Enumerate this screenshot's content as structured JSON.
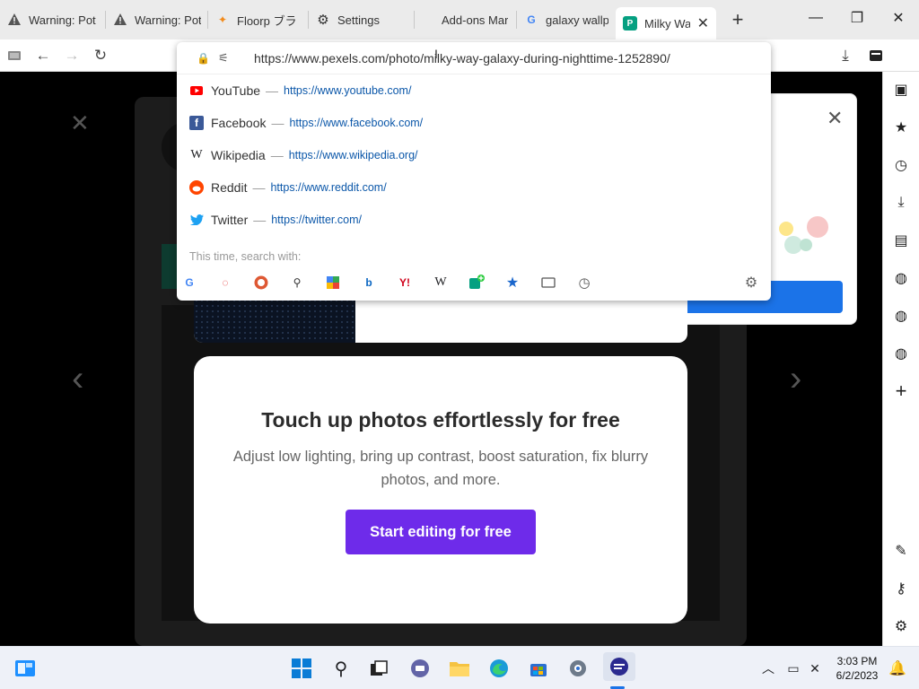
{
  "tabs": [
    {
      "label": "Warning: Pot",
      "icon": "warning-icon"
    },
    {
      "label": "Warning: Pot",
      "icon": "warning-icon"
    },
    {
      "label": "Floorp ブラ",
      "icon": "floorp-icon"
    },
    {
      "label": "Settings",
      "icon": "gear-icon"
    },
    {
      "label": "Add-ons Mar",
      "icon": "addons-icon"
    },
    {
      "label": "galaxy wallpa",
      "icon": "google-icon"
    },
    {
      "label": "Milky Way",
      "icon": "pexels-icon"
    }
  ],
  "address_bar": {
    "url": "https://www.pexels.com/photo/milky-way-galaxy-during-nighttime-1252890/"
  },
  "suggestions": [
    {
      "name": "YouTube",
      "url": "https://www.youtube.com/",
      "icon": "youtube-icon",
      "color": "#ff0000"
    },
    {
      "name": "Facebook",
      "url": "https://www.facebook.com/",
      "icon": "facebook-icon",
      "color": "#3b5998"
    },
    {
      "name": "Wikipedia",
      "url": "https://www.wikipedia.org/",
      "icon": "wikipedia-icon",
      "color": "#333333"
    },
    {
      "name": "Reddit",
      "url": "https://www.reddit.com/",
      "icon": "reddit-icon",
      "color": "#ff4500"
    },
    {
      "name": "Twitter",
      "url": "https://twitter.com/",
      "icon": "twitter-icon",
      "color": "#1da1f2"
    }
  ],
  "search_with_label": "This time, search with:",
  "search_engines": [
    "google-icon",
    "ecosia-icon",
    "duckduckgo-icon",
    "search-icon",
    "startpage-icon",
    "bing-icon",
    "yahoo-icon",
    "wikipedia-icon",
    "addengine-icon",
    "bookmarks-icon",
    "tabs-icon",
    "history-icon"
  ],
  "promo": {
    "title": "Touch up photos effortlessly for free",
    "subtitle": "Adjust low lighting, bring up contrast, boost saturation, fix blurry photos, and more.",
    "button": "Start editing for free"
  },
  "clock": {
    "time": "3:03 PM",
    "date": "6/2/2023"
  },
  "colors": {
    "accent_purple": "#6e2bea",
    "blue": "#1b73e8"
  }
}
